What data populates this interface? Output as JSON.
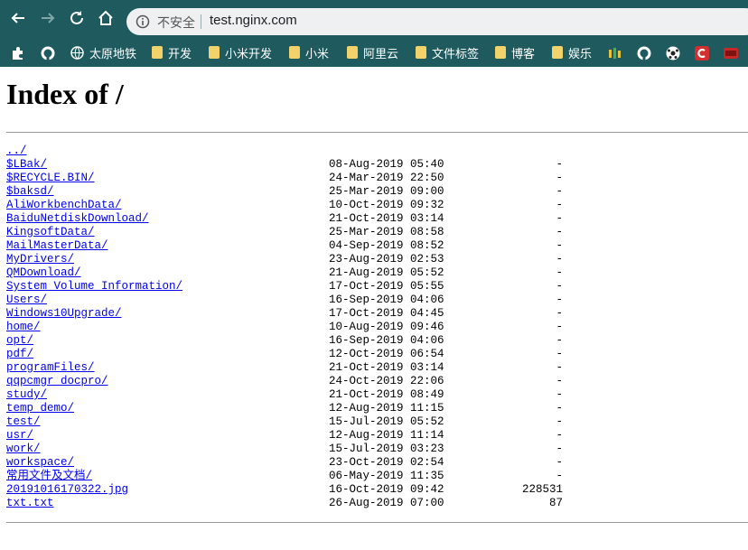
{
  "browser": {
    "security_label": "不安全",
    "url": "test.nginx.com"
  },
  "bookmarks": [
    {
      "label": "太原地铁",
      "icon": "globe-icon"
    },
    {
      "label": "开发",
      "icon": "folder-icon"
    },
    {
      "label": "小米开发",
      "icon": "folder-icon"
    },
    {
      "label": "小米",
      "icon": "folder-icon"
    },
    {
      "label": "阿里云",
      "icon": "folder-icon"
    },
    {
      "label": "文件标签",
      "icon": "folder-icon"
    },
    {
      "label": "博客",
      "icon": "folder-icon"
    },
    {
      "label": "娱乐",
      "icon": "folder-icon"
    }
  ],
  "page": {
    "title": "Index of /",
    "entries": [
      {
        "name": "../",
        "date": "",
        "size": ""
      },
      {
        "name": "$LBak/",
        "date": "08-Aug-2019 05:40",
        "size": "-"
      },
      {
        "name": "$RECYCLE.BIN/",
        "date": "24-Mar-2019 22:50",
        "size": "-"
      },
      {
        "name": "$baksd/",
        "date": "25-Mar-2019 09:00",
        "size": "-"
      },
      {
        "name": "AliWorkbenchData/",
        "date": "10-Oct-2019 09:32",
        "size": "-"
      },
      {
        "name": "BaiduNetdiskDownload/",
        "date": "21-Oct-2019 03:14",
        "size": "-"
      },
      {
        "name": "KingsoftData/",
        "date": "25-Mar-2019 08:58",
        "size": "-"
      },
      {
        "name": "MailMasterData/",
        "date": "04-Sep-2019 08:52",
        "size": "-"
      },
      {
        "name": "MyDrivers/",
        "date": "23-Aug-2019 02:53",
        "size": "-"
      },
      {
        "name": "QMDownload/",
        "date": "21-Aug-2019 05:52",
        "size": "-"
      },
      {
        "name": "System Volume Information/",
        "date": "17-Oct-2019 05:55",
        "size": "-"
      },
      {
        "name": "Users/",
        "date": "16-Sep-2019 04:06",
        "size": "-"
      },
      {
        "name": "Windows10Upgrade/",
        "date": "17-Oct-2019 04:45",
        "size": "-"
      },
      {
        "name": "home/",
        "date": "10-Aug-2019 09:46",
        "size": "-"
      },
      {
        "name": "opt/",
        "date": "16-Sep-2019 04:06",
        "size": "-"
      },
      {
        "name": "pdf/",
        "date": "12-Oct-2019 06:54",
        "size": "-"
      },
      {
        "name": "programFiles/",
        "date": "21-Oct-2019 03:14",
        "size": "-"
      },
      {
        "name": "qqpcmgr_docpro/",
        "date": "24-Oct-2019 22:06",
        "size": "-"
      },
      {
        "name": "study/",
        "date": "21-Oct-2019 08:49",
        "size": "-"
      },
      {
        "name": "temp_demo/",
        "date": "12-Aug-2019 11:15",
        "size": "-"
      },
      {
        "name": "test/",
        "date": "15-Jul-2019 05:52",
        "size": "-"
      },
      {
        "name": "usr/",
        "date": "12-Aug-2019 11:14",
        "size": "-"
      },
      {
        "name": "work/",
        "date": "15-Jul-2019 03:23",
        "size": "-"
      },
      {
        "name": "workspace/",
        "date": "23-Oct-2019 02:54",
        "size": "-"
      },
      {
        "name": "常用文件及文档/",
        "date": "06-May-2019 11:35",
        "size": "-"
      },
      {
        "name": "20191016170322.jpg",
        "date": "16-Oct-2019 09:42",
        "size": "228531"
      },
      {
        "name": "txt.txt",
        "date": "26-Aug-2019 07:00",
        "size": "87"
      }
    ]
  }
}
